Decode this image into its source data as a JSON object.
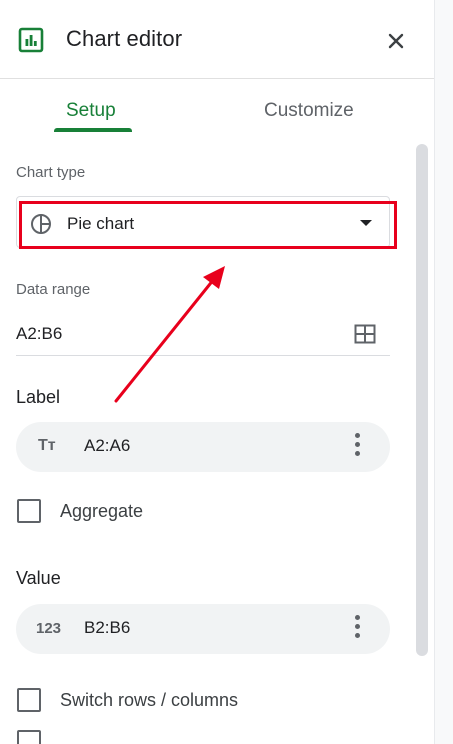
{
  "header": {
    "title": "Chart editor",
    "icon": "chart-icon",
    "close_icon": "close-icon"
  },
  "tabs": [
    {
      "label": "Setup",
      "active": true
    },
    {
      "label": "Customize",
      "active": false
    }
  ],
  "chart_type": {
    "label": "Chart type",
    "value": "Pie chart",
    "icon": "pie-chart-icon"
  },
  "data_range": {
    "label": "Data range",
    "value": "A2:B6",
    "icon": "grid-icon"
  },
  "label_section": {
    "heading": "Label",
    "chip_icon_text": "Tт",
    "chip_value": "A2:A6"
  },
  "aggregate": {
    "label": "Aggregate",
    "checked": false
  },
  "value_section": {
    "heading": "Value",
    "chip_icon_text": "123",
    "chip_value": "B2:B6"
  },
  "switch_rows": {
    "label": "Switch rows / columns",
    "checked": false
  },
  "colors": {
    "accent": "#188038",
    "annotation": "#e8001c"
  }
}
